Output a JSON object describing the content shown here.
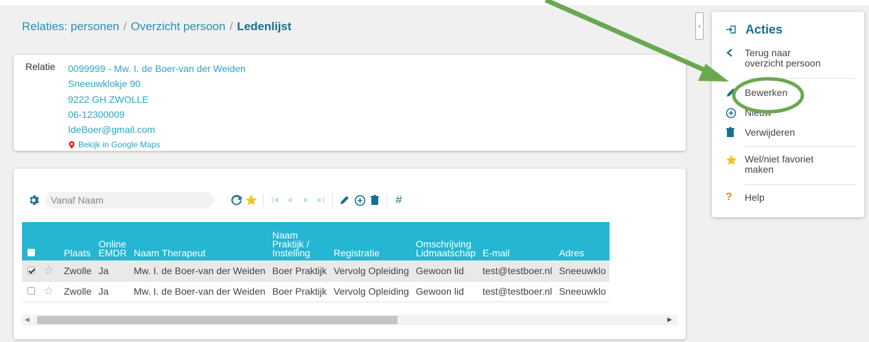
{
  "breadcrumb": {
    "item1": "Relaties: personen",
    "separator": "/",
    "item2": "Overzicht persoon",
    "current": "Ledenlijst"
  },
  "relatie": {
    "label": "Relatie",
    "name_line": "0099999 - Mw. I. de Boer-van der Weiden",
    "street": "Sneeuwklokje 90",
    "postal": "9222 GH ZWOLLE",
    "phone": "06-12300009",
    "email": "IdeBoer@gmail.com",
    "maps_link": "Bekijk in Google Maps"
  },
  "toolbar": {
    "search_placeholder": "Vanaf Naam",
    "hash": "#"
  },
  "table": {
    "headers": {
      "plaats": "Plaats",
      "online_line1": "Online",
      "online_line2": "EMDR",
      "naam_therapeut": "Naam Therapeut",
      "naam_praktijk_line1": "Naam",
      "naam_praktijk_line2": "Praktijk /",
      "naam_praktijk_line3": "Instelling",
      "registratie": "Registratie",
      "omschrijving_line1": "Omschrijving",
      "omschrijving_line2": "Lidmaatschap",
      "email": "E-mail",
      "adres": "Adres"
    },
    "rows": [
      {
        "checked": true,
        "plaats": "Zwolle",
        "online": "Ja",
        "naam": "Mw. I. de Boer-van der Weiden",
        "praktijk": "Boer Praktijk",
        "registratie": "Vervolg Opleiding",
        "lidmaatschap": "Gewoon lid",
        "email": "test@testboer.nl",
        "adres": "Sneeuwklo"
      },
      {
        "checked": false,
        "plaats": "Zwolle",
        "online": "Ja",
        "naam": "Mw. I. de Boer-van der Weiden",
        "praktijk": "Boer Praktijk",
        "registratie": "Vervolg Opleiding",
        "lidmaatschap": "Gewoon lid",
        "email": "test@testboer.nl",
        "adres": "Sneeuwklo"
      }
    ]
  },
  "acties": {
    "title": "Acties",
    "terug_line1": "Terug naar",
    "terug_line2": "overzicht persoon",
    "bewerken": "Bewerken",
    "nieuw": "Nieuw",
    "verwijderen": "Verwijderen",
    "favoriet_line1": "Wel/niet favoriet",
    "favoriet_line2": "maken",
    "help": "Help"
  },
  "colors": {
    "accent": "#24b6d2",
    "link": "#2aa7c2",
    "annotation": "#6aa84f",
    "star": "#f5c518",
    "help": "#f08a24"
  }
}
